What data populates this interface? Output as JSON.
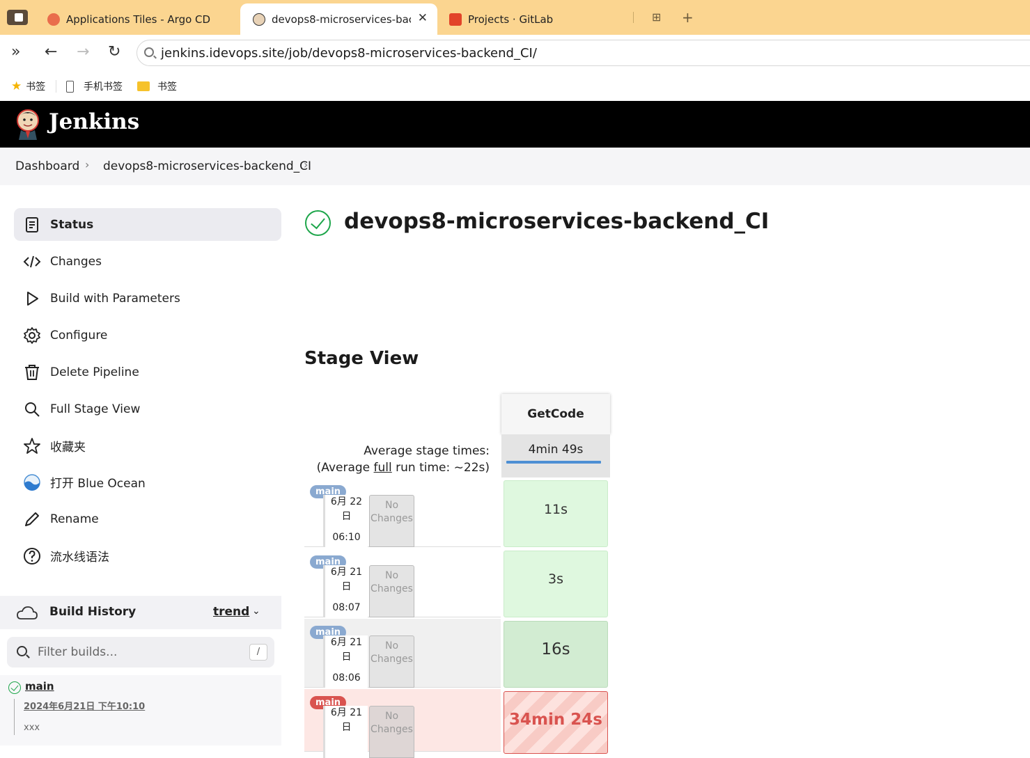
{
  "browser": {
    "tabs": [
      {
        "title": "Applications Tiles - Argo CD",
        "active": false
      },
      {
        "title": "devops8-microservices-backend_CI",
        "active": true
      },
      {
        "title": "Projects · GitLab",
        "active": false
      }
    ],
    "url": "jenkins.idevops.site/job/devops8-microservices-backend_CI/",
    "bookmarks": [
      {
        "label": "书签",
        "icon": "star-icon"
      },
      {
        "label": "手机书签",
        "icon": "phone-icon"
      },
      {
        "label": "书签",
        "icon": "folder-icon"
      }
    ]
  },
  "header": {
    "brand": "Jenkins"
  },
  "breadcrumb": [
    "Dashboard",
    "devops8-microservices-backend_CI"
  ],
  "sidebar": {
    "items": [
      {
        "label": "Status",
        "icon": "status-icon"
      },
      {
        "label": "Changes",
        "icon": "code-icon"
      },
      {
        "label": "Build with Parameters",
        "icon": "play-icon"
      },
      {
        "label": "Configure",
        "icon": "gear-icon"
      },
      {
        "label": "Delete Pipeline",
        "icon": "trash-icon"
      },
      {
        "label": "Full Stage View",
        "icon": "search-icon"
      },
      {
        "label": "收藏夹",
        "icon": "star-icon"
      },
      {
        "label": "打开 Blue Ocean",
        "icon": "blue-ocean-icon"
      },
      {
        "label": "Rename",
        "icon": "pencil-icon"
      },
      {
        "label": "流水线语法",
        "icon": "help-icon"
      }
    ]
  },
  "build_history": {
    "title": "Build History",
    "trend": "trend",
    "filter_placeholder": "Filter builds...",
    "filter_shortcut": "/",
    "builds": [
      {
        "name": "main",
        "date": "2024年6月21日 下午10:10",
        "message": "xxx",
        "status": "success"
      }
    ]
  },
  "main": {
    "title": "devops8-microservices-backend_CI",
    "stage_view_title": "Stage View",
    "avg_stage_times_label": "Average stage times:",
    "avg_full_prefix": "(Average ",
    "avg_full_link": "full",
    "avg_full_suffix": " run time: ~22s)",
    "stages": [
      {
        "name": "GetCode",
        "avg": "4min 49s"
      }
    ],
    "runs": [
      {
        "branch": "main",
        "date": "6月 22",
        "day": "日",
        "time": "06:10",
        "changes": "No Changes",
        "status": "success",
        "durations": [
          "11s"
        ]
      },
      {
        "branch": "main",
        "date": "6月 21",
        "day": "日",
        "time": "08:07",
        "changes": "No Changes",
        "status": "success",
        "durations": [
          "3s"
        ]
      },
      {
        "branch": "main",
        "date": "6月 21",
        "day": "日",
        "time": "08:06",
        "changes": "No Changes",
        "status": "success",
        "durations": [
          "16s"
        ]
      },
      {
        "branch": "main",
        "date": "6月 21",
        "day": "日",
        "time": "",
        "changes": "No Changes",
        "status": "failed",
        "durations": [
          "34min 24s"
        ]
      }
    ]
  }
}
